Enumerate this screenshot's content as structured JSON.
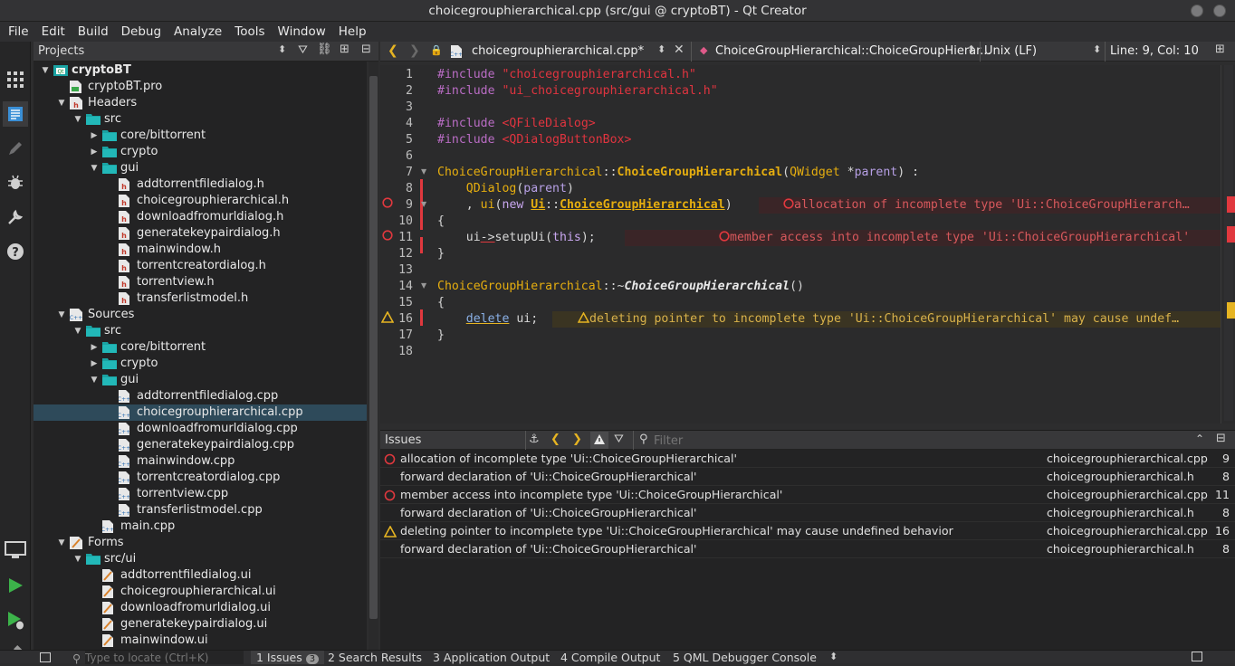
{
  "window": {
    "title": "choicegrouphierarchical.cpp (src/gui @ cryptoBT) - Qt Creator"
  },
  "menu": [
    "File",
    "Edit",
    "Build",
    "Debug",
    "Analyze",
    "Tools",
    "Window",
    "Help"
  ],
  "projects": {
    "header": "Projects",
    "tree": [
      {
        "label": "cryptoBT",
        "depth": 0,
        "arrow": "down",
        "icon": "project",
        "bold": true
      },
      {
        "label": "cryptoBT.pro",
        "depth": 1,
        "arrow": "",
        "icon": "pro"
      },
      {
        "label": "Headers",
        "depth": 1,
        "arrow": "down",
        "icon": "headers"
      },
      {
        "label": "src",
        "depth": 2,
        "arrow": "down",
        "icon": "folder"
      },
      {
        "label": "core/bittorrent",
        "depth": 3,
        "arrow": "right",
        "icon": "folder"
      },
      {
        "label": "crypto",
        "depth": 3,
        "arrow": "right",
        "icon": "folder"
      },
      {
        "label": "gui",
        "depth": 3,
        "arrow": "down",
        "icon": "folder"
      },
      {
        "label": "addtorrentfiledialog.h",
        "depth": 4,
        "arrow": "",
        "icon": "h"
      },
      {
        "label": "choicegrouphierarchical.h",
        "depth": 4,
        "arrow": "",
        "icon": "h"
      },
      {
        "label": "downloadfromurldialog.h",
        "depth": 4,
        "arrow": "",
        "icon": "h"
      },
      {
        "label": "generatekeypairdialog.h",
        "depth": 4,
        "arrow": "",
        "icon": "h"
      },
      {
        "label": "mainwindow.h",
        "depth": 4,
        "arrow": "",
        "icon": "h"
      },
      {
        "label": "torrentcreatordialog.h",
        "depth": 4,
        "arrow": "",
        "icon": "h"
      },
      {
        "label": "torrentview.h",
        "depth": 4,
        "arrow": "",
        "icon": "h"
      },
      {
        "label": "transferlistmodel.h",
        "depth": 4,
        "arrow": "",
        "icon": "h"
      },
      {
        "label": "Sources",
        "depth": 1,
        "arrow": "down",
        "icon": "sources"
      },
      {
        "label": "src",
        "depth": 2,
        "arrow": "down",
        "icon": "folder"
      },
      {
        "label": "core/bittorrent",
        "depth": 3,
        "arrow": "right",
        "icon": "folder"
      },
      {
        "label": "crypto",
        "depth": 3,
        "arrow": "right",
        "icon": "folder"
      },
      {
        "label": "gui",
        "depth": 3,
        "arrow": "down",
        "icon": "folder"
      },
      {
        "label": "addtorrentfiledialog.cpp",
        "depth": 4,
        "arrow": "",
        "icon": "cpp"
      },
      {
        "label": "choicegrouphierarchical.cpp",
        "depth": 4,
        "arrow": "",
        "icon": "cpp",
        "selected": true
      },
      {
        "label": "downloadfromurldialog.cpp",
        "depth": 4,
        "arrow": "",
        "icon": "cpp"
      },
      {
        "label": "generatekeypairdialog.cpp",
        "depth": 4,
        "arrow": "",
        "icon": "cpp"
      },
      {
        "label": "mainwindow.cpp",
        "depth": 4,
        "arrow": "",
        "icon": "cpp"
      },
      {
        "label": "torrentcreatordialog.cpp",
        "depth": 4,
        "arrow": "",
        "icon": "cpp"
      },
      {
        "label": "torrentview.cpp",
        "depth": 4,
        "arrow": "",
        "icon": "cpp"
      },
      {
        "label": "transferlistmodel.cpp",
        "depth": 4,
        "arrow": "",
        "icon": "cpp"
      },
      {
        "label": "main.cpp",
        "depth": 3,
        "arrow": "",
        "icon": "cpp"
      },
      {
        "label": "Forms",
        "depth": 1,
        "arrow": "down",
        "icon": "forms"
      },
      {
        "label": "src/ui",
        "depth": 2,
        "arrow": "down",
        "icon": "folder"
      },
      {
        "label": "addtorrentfiledialog.ui",
        "depth": 3,
        "arrow": "",
        "icon": "ui"
      },
      {
        "label": "choicegrouphierarchical.ui",
        "depth": 3,
        "arrow": "",
        "icon": "ui"
      },
      {
        "label": "downloadfromurldialog.ui",
        "depth": 3,
        "arrow": "",
        "icon": "ui"
      },
      {
        "label": "generatekeypairdialog.ui",
        "depth": 3,
        "arrow": "",
        "icon": "ui"
      },
      {
        "label": "mainwindow.ui",
        "depth": 3,
        "arrow": "",
        "icon": "ui"
      }
    ]
  },
  "editor": {
    "file_tab": "choicegrouphierarchical.cpp*",
    "symbol": "ChoiceGroupHierarchical::ChoiceGroupHierar...",
    "line_ending": "Unix (LF)",
    "position": "Line: 9, Col: 10",
    "line_numbers": [
      "1",
      "2",
      "3",
      "4",
      "5",
      "6",
      "7",
      "8",
      "9",
      "10",
      "11",
      "12",
      "13",
      "14",
      "15",
      "16",
      "17",
      "18"
    ],
    "inline_messages": {
      "line9": "allocation of incomplete type 'Ui::ChoiceGroupHierarch…",
      "line11": "member access into incomplete type 'Ui::ChoiceGroupHierarchical'",
      "line16": "deleting pointer to incomplete type 'Ui::ChoiceGroupHierarchical' may cause undef…"
    }
  },
  "issues_panel": {
    "title": "Issues",
    "filter_placeholder": "Filter",
    "rows": [
      {
        "severity": "error",
        "message": "allocation of incomplete type 'Ui::ChoiceGroupHierarchical'",
        "file": "choicegrouphierarchical.cpp",
        "line": "9"
      },
      {
        "severity": "",
        "message": "forward declaration of 'Ui::ChoiceGroupHierarchical'",
        "file": "choicegrouphierarchical.h",
        "line": "8"
      },
      {
        "severity": "error",
        "message": "member access into incomplete type 'Ui::ChoiceGroupHierarchical'",
        "file": "choicegrouphierarchical.cpp",
        "line": "11"
      },
      {
        "severity": "",
        "message": "forward declaration of 'Ui::ChoiceGroupHierarchical'",
        "file": "choicegrouphierarchical.h",
        "line": "8"
      },
      {
        "severity": "warning",
        "message": "deleting pointer to incomplete type 'Ui::ChoiceGroupHierarchical' may cause undefined behavior",
        "file": "choicegrouphierarchical.cpp",
        "line": "16"
      },
      {
        "severity": "",
        "message": "forward declaration of 'Ui::ChoiceGroupHierarchical'",
        "file": "choicegrouphierarchical.h",
        "line": "8"
      }
    ]
  },
  "statusbar": {
    "locator_placeholder": "Type to locate (Ctrl+K)",
    "tabs": [
      {
        "label": "1  Issues",
        "badge": "3"
      },
      {
        "label": "2  Search Results"
      },
      {
        "label": "3  Application Output"
      },
      {
        "label": "4  Compile Output"
      },
      {
        "label": "5  QML Debugger Console"
      }
    ]
  },
  "colors": {
    "error": "#e0383e",
    "warning": "#e6b422",
    "selection": "#2e4a5a",
    "folder": "#1aa3a3"
  }
}
